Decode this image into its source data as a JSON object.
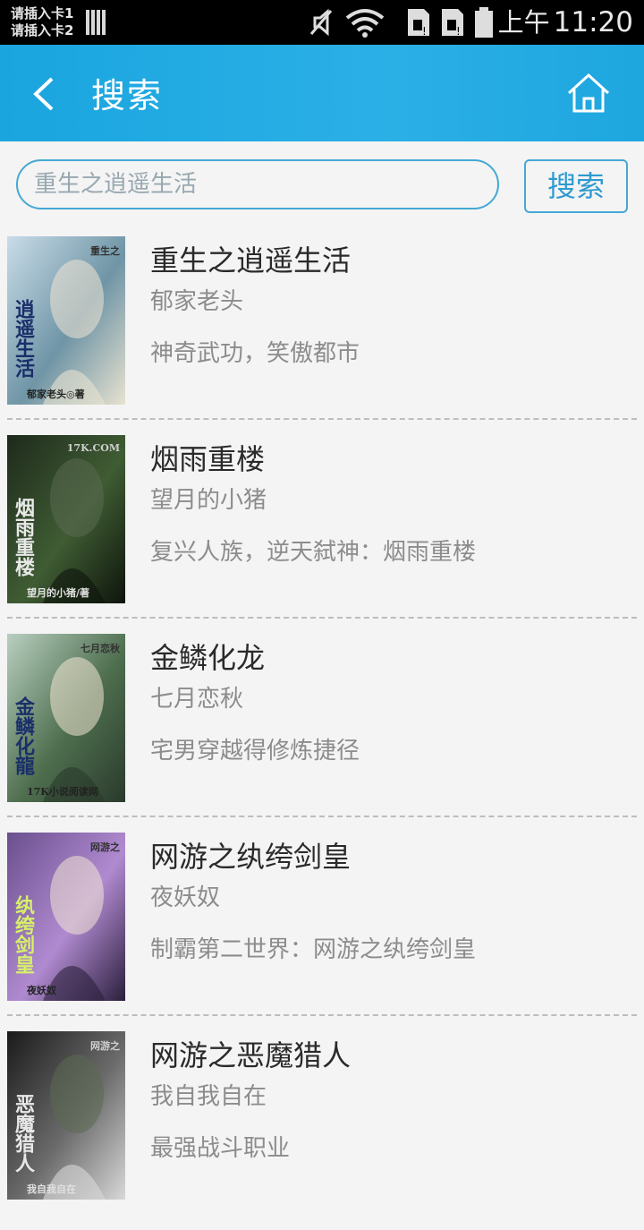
{
  "status_bar": {
    "sim_lines": [
      "请插入卡1",
      "请插入卡2"
    ],
    "ampm": "上午",
    "time": "11:20"
  },
  "header": {
    "title": "搜索",
    "back_icon": "chevron-left-icon",
    "home_icon": "home-icon"
  },
  "search": {
    "query": "重生之逍遥生活",
    "button_label": "搜索"
  },
  "colors": {
    "accent": "#1ea6df",
    "search_border": "#45a8d4"
  },
  "results": [
    {
      "title": "重生之逍遥生活",
      "author": "郁家老头",
      "desc": "神奇武功，笑傲都市",
      "cover_title": "逍遥生活",
      "cover_sub": "重生之",
      "cover_author": "郁家老头◎著",
      "cover_palette": [
        "#c9dce8",
        "#6f95a6",
        "#e8e2d0"
      ]
    },
    {
      "title": "烟雨重楼",
      "author": "望月的小猪",
      "desc": "复兴人族，逆天弑神：烟雨重楼",
      "cover_title": "烟雨重楼",
      "cover_sub": "17K.COM",
      "cover_author": "望月的小猪/著",
      "cover_palette": [
        "#1e2a1c",
        "#3f5c33",
        "#0e140c"
      ]
    },
    {
      "title": "金鳞化龙",
      "author": "七月恋秋",
      "desc": "宅男穿越得修炼捷径",
      "cover_title": "金鳞化龍",
      "cover_sub": "七月恋秋",
      "cover_author": "17K小说阅读网",
      "cover_palette": [
        "#b8cfc0",
        "#4e6e4e",
        "#2a3a2c"
      ]
    },
    {
      "title": "网游之纨绔剑皇",
      "author": "夜妖奴",
      "desc": "制霸第二世界：网游之纨绔剑皇",
      "cover_title": "纨绔剑皇",
      "cover_sub": "网游之",
      "cover_author": "夜妖奴",
      "cover_palette": [
        "#6a4f8e",
        "#b08ad0",
        "#2b1f3c"
      ]
    },
    {
      "title": "网游之恶魔猎人",
      "author": "我自我自在",
      "desc": "最强战斗职业",
      "cover_title": "恶魔猎人",
      "cover_sub": "网游之",
      "cover_author": "我自我自在",
      "cover_palette": [
        "#1a1a1a",
        "#6b6b6b",
        "#d8d8d8"
      ]
    }
  ]
}
